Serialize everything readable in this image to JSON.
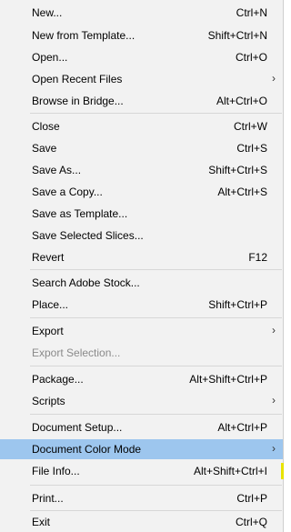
{
  "menu": {
    "items": [
      {
        "label": "New...",
        "shortcut": "Ctrl+N"
      },
      {
        "label": "New from Template...",
        "shortcut": "Shift+Ctrl+N"
      },
      {
        "label": "Open...",
        "shortcut": "Ctrl+O"
      },
      {
        "label": "Open Recent Files",
        "shortcut": "",
        "submenu_glyph": "›"
      },
      {
        "label": "Browse in Bridge...",
        "shortcut": "Alt+Ctrl+O"
      },
      {
        "label": "Close",
        "shortcut": "Ctrl+W"
      },
      {
        "label": "Save",
        "shortcut": "Ctrl+S"
      },
      {
        "label": "Save As...",
        "shortcut": "Shift+Ctrl+S"
      },
      {
        "label": "Save a Copy...",
        "shortcut": "Alt+Ctrl+S"
      },
      {
        "label": "Save as Template...",
        "shortcut": ""
      },
      {
        "label": "Save Selected Slices...",
        "shortcut": ""
      },
      {
        "label": "Revert",
        "shortcut": "F12"
      },
      {
        "label": "Search Adobe Stock...",
        "shortcut": ""
      },
      {
        "label": "Place...",
        "shortcut": "Shift+Ctrl+P"
      },
      {
        "label": "Export",
        "shortcut": "",
        "submenu_glyph": "›"
      },
      {
        "label": "Export Selection...",
        "shortcut": "",
        "state": "disabled"
      },
      {
        "label": "Package...",
        "shortcut": "Alt+Shift+Ctrl+P"
      },
      {
        "label": "Scripts",
        "shortcut": "",
        "submenu_glyph": "›"
      },
      {
        "label": "Document Setup...",
        "shortcut": "Alt+Ctrl+P"
      },
      {
        "label": "Document Color Mode",
        "shortcut": "",
        "submenu_glyph": "›",
        "state": "highlighted"
      },
      {
        "label": "File Info...",
        "shortcut": "Alt+Shift+Ctrl+I"
      },
      {
        "label": "Print...",
        "shortcut": "Ctrl+P"
      },
      {
        "label": "Exit",
        "shortcut": "Ctrl+Q"
      }
    ]
  },
  "colors": {
    "menu_background": "#f2f2f2",
    "highlight": "#9dc6ee",
    "disabled_text": "#8a8a8a",
    "marker": "#e9e300"
  }
}
